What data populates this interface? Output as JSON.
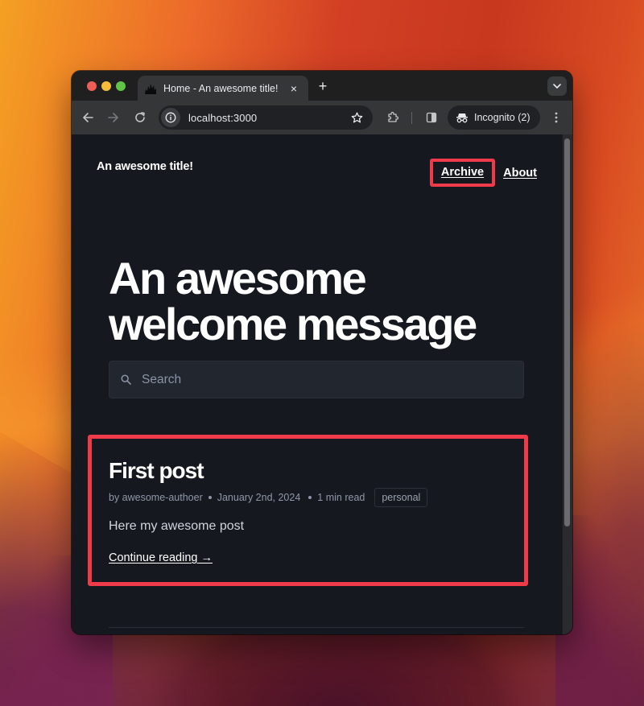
{
  "browser": {
    "tab": {
      "title": "Home - An awesome title!",
      "favicon": "flame-icon",
      "close_label": "×"
    },
    "new_tab_label": "+",
    "address_bar": {
      "url": "localhost:3000",
      "site_info_icon": "info-icon",
      "bookmark_icon": "star-icon"
    },
    "incognito": {
      "label": "Incognito (2)",
      "icon": "incognito-icon"
    },
    "buttons": [
      "back",
      "forward",
      "reload",
      "extensions",
      "side-panel",
      "menu",
      "tab-search"
    ]
  },
  "site": {
    "title": "An awesome title!",
    "nav": [
      {
        "label": "Archive",
        "highlighted": true
      },
      {
        "label": "About",
        "highlighted": false
      }
    ],
    "hero": {
      "line1": "An awesome",
      "line2": "welcome message"
    },
    "search": {
      "placeholder": "Search",
      "value": ""
    },
    "posts": [
      {
        "title": "First post",
        "author": "by awesome-authoer",
        "date": "January 2nd, 2024",
        "read_time": "1 min read",
        "tag": "personal",
        "excerpt": "Here my awesome post",
        "link_label": "Continue reading →",
        "highlighted": true
      }
    ]
  },
  "colors": {
    "highlight": "#ef3a4a",
    "page_background": "#15181e",
    "search_background": "#22262f",
    "meta_text": "#8f97a8"
  }
}
